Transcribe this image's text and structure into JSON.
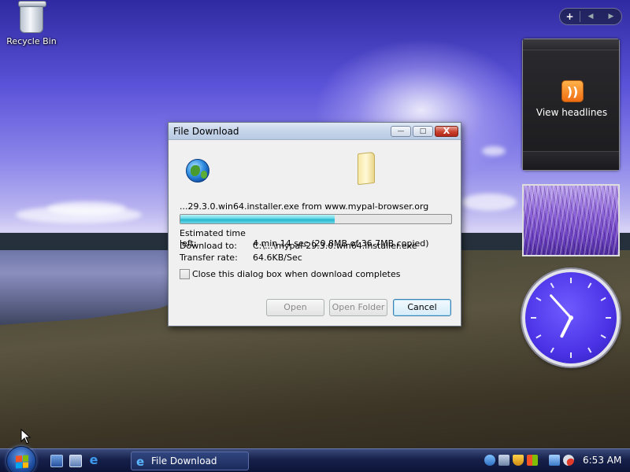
{
  "desktop": {
    "recycle_bin_label": "Recycle Bin"
  },
  "sidebar": {
    "add_label": "+",
    "prev_label": "◀",
    "next_label": "▶",
    "rss_gadget": {
      "label": "View headlines",
      "icon": "rss-icon"
    },
    "slideshow_gadget": {
      "icon": "photo-slideshow"
    },
    "clock_gadget": {
      "hour": 6,
      "minute": 53
    }
  },
  "dialog": {
    "title": "File Download",
    "controls": {
      "minimize": "—",
      "maximize": "□",
      "close": "X"
    },
    "source_text": "...29.3.0.win64.installer.exe from www.mypal-browser.org",
    "progress_percent": 57,
    "estimated_label": "Estimated time left:",
    "estimated_value": "4 min 14 sec (20.8MB of 36.7MB copied)",
    "download_to_label": "Download to:",
    "download_to_value": "C:\\...\\mypal-29.3.0.win64.installer.exe",
    "transfer_label": "Transfer rate:",
    "transfer_value": "64.6KB/Sec",
    "close_checkbox_label": "Close this dialog box when download completes",
    "close_checkbox_checked": false,
    "buttons": {
      "open": "Open",
      "open_folder": "Open Folder",
      "cancel": "Cancel"
    }
  },
  "taskbar": {
    "active_task_label": "File Download",
    "clock_text": "6:53 AM",
    "colors": {
      "taskbar": "#16204a",
      "accent": "#3c7fb1"
    }
  }
}
